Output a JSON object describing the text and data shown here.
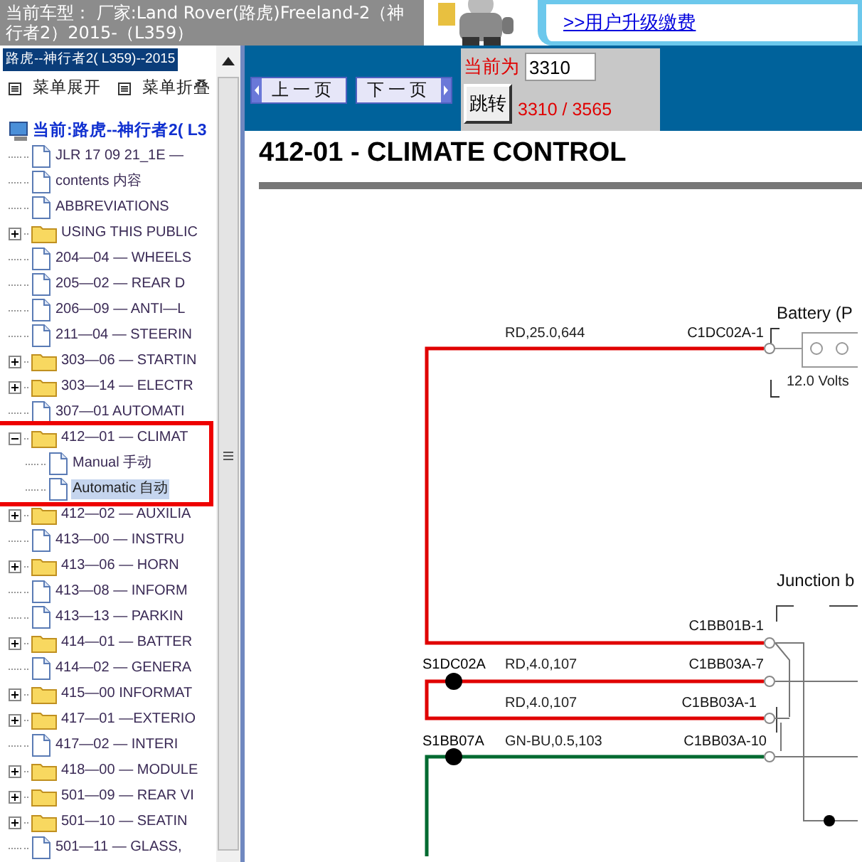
{
  "header": {
    "car_model": "当前车型： 厂家:Land Rover(路虎)Freeland-2（神行者2）2015-（L359）",
    "ad_link": ">>用户升级缴费"
  },
  "sidebar": {
    "title": "路虎--神行者2( L359)--2015",
    "menu_actions": [
      "菜单展开",
      "菜单折叠"
    ],
    "root": "当前:路虎--神行者2( L3",
    "items": [
      {
        "label": "JLR 17 09 21_1E —",
        "kind": "doc",
        "selected": false
      },
      {
        "label": "contents 内容",
        "kind": "doc",
        "selected": false
      },
      {
        "label": "ABBREVIATIONS",
        "kind": "doc",
        "selected": false
      },
      {
        "label": "USING THIS PUBLIC",
        "kind": "folder",
        "expanded": false,
        "selected": false
      },
      {
        "label": "204—04 — WHEELS",
        "kind": "doc",
        "selected": false
      },
      {
        "label": "205—02 — REAR D",
        "kind": "doc",
        "selected": false
      },
      {
        "label": "206—09 — ANTI—L",
        "kind": "doc",
        "selected": false
      },
      {
        "label": "211—04 — STEERIN",
        "kind": "doc",
        "selected": false
      },
      {
        "label": "303—06 — STARTIN",
        "kind": "folder",
        "expanded": false,
        "selected": false
      },
      {
        "label": "303—14 — ELECTR",
        "kind": "folder",
        "expanded": false,
        "selected": false
      },
      {
        "label": "307—01 AUTOMATI",
        "kind": "doc",
        "selected": false
      },
      {
        "label": "412—01 — CLIMAT",
        "kind": "folder",
        "expanded": true,
        "selected": false,
        "highlighted": true,
        "children": [
          {
            "label": "Manual 手动",
            "kind": "doc",
            "selected": false
          },
          {
            "label": "Automatic 自动",
            "kind": "doc",
            "selected": true
          }
        ]
      },
      {
        "label": "412—02 — AUXILIA",
        "kind": "folder",
        "expanded": false,
        "selected": false
      },
      {
        "label": "413—00 — INSTRU",
        "kind": "doc",
        "selected": false
      },
      {
        "label": "413—06 — HORN",
        "kind": "folder",
        "expanded": false,
        "selected": false
      },
      {
        "label": "413—08 — INFORM",
        "kind": "doc",
        "selected": false
      },
      {
        "label": "413—13 — PARKIN",
        "kind": "doc",
        "selected": false
      },
      {
        "label": "414—01 — BATTER",
        "kind": "folder",
        "expanded": false,
        "selected": false
      },
      {
        "label": "414—02 — GENERA",
        "kind": "doc",
        "selected": false
      },
      {
        "label": "415—00 INFORMAT",
        "kind": "folder",
        "expanded": false,
        "selected": false
      },
      {
        "label": "417—01 —EXTERIO",
        "kind": "folder",
        "expanded": false,
        "selected": false
      },
      {
        "label": "417—02 — INTERI",
        "kind": "doc",
        "selected": false
      },
      {
        "label": "418—00 — MODULE",
        "kind": "folder",
        "expanded": false,
        "selected": false
      },
      {
        "label": "501—09 — REAR VI",
        "kind": "folder",
        "expanded": false,
        "selected": false
      },
      {
        "label": "501—10 — SEATIN",
        "kind": "folder",
        "expanded": false,
        "selected": false
      },
      {
        "label": "501—11 — GLASS,",
        "kind": "doc",
        "selected": false
      }
    ]
  },
  "pager": {
    "prev": "上一页",
    "next": "下一页",
    "current_label": "当前为",
    "page_input": "3310",
    "go": "跳转",
    "position": "3310 / 3565"
  },
  "document": {
    "title": "412-01 - CLIMATE CONTROL",
    "diagram": {
      "battery_label": "Battery (P",
      "battery_volts": "12.0 Volts",
      "junction_label": "Junction b",
      "labels": [
        {
          "text": "RD,25.0,644",
          "kind": "wire"
        },
        {
          "text": "C1DC02A-1",
          "kind": "pin"
        },
        {
          "text": "C1BB01B-1",
          "kind": "pin"
        },
        {
          "text": "S1DC02A",
          "kind": "splice"
        },
        {
          "text": "RD,4.0,107",
          "kind": "wire"
        },
        {
          "text": "C1BB03A-7",
          "kind": "pin"
        },
        {
          "text": "RD,4.0,107",
          "kind": "wire"
        },
        {
          "text": "C1BB03A-1",
          "kind": "pin"
        },
        {
          "text": "S1BB07A",
          "kind": "splice"
        },
        {
          "text": "GN-BU,0.5,103",
          "kind": "wire"
        },
        {
          "text": "C1BB03A-10",
          "kind": "pin"
        }
      ]
    }
  }
}
